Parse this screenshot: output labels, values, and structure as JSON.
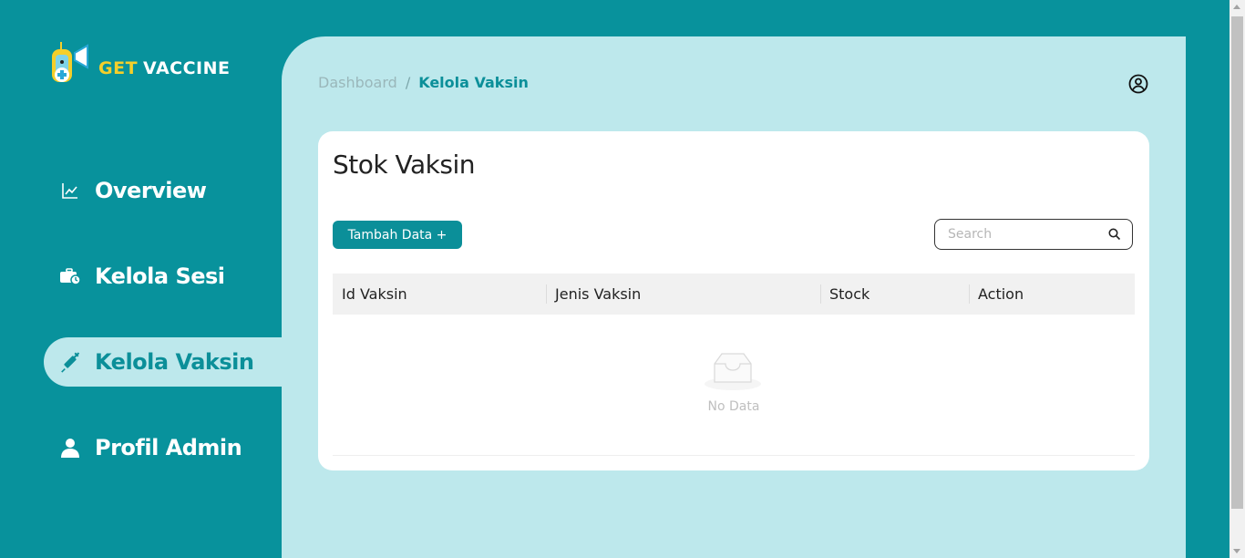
{
  "app": {
    "logo_text_1": "GET",
    "logo_text_2": "VACCINE",
    "accent_color": "#08929c",
    "logo_accent": "#f5cf2a"
  },
  "sidebar": {
    "items": [
      {
        "label": "Overview",
        "icon": "chart-line-icon",
        "active": false
      },
      {
        "label": "Kelola Sesi",
        "icon": "medical-kit-clock-icon",
        "active": false
      },
      {
        "label": "Kelola Vaksin",
        "icon": "syringe-icon",
        "active": true
      },
      {
        "label": "Profil Admin",
        "icon": "user-icon",
        "active": false
      }
    ]
  },
  "header": {
    "breadcrumb_parent": "Dashboard",
    "breadcrumb_separator": "/",
    "breadcrumb_current": "Kelola Vaksin",
    "profile_icon": "user-circle-icon"
  },
  "card": {
    "title": "Stok Vaksin",
    "add_button_label": "Tambah Data +",
    "search_placeholder": "Search",
    "columns": [
      "Id Vaksin",
      "Jenis Vaksin",
      "Stock",
      "Action"
    ],
    "rows": [],
    "empty_text": "No Data"
  }
}
